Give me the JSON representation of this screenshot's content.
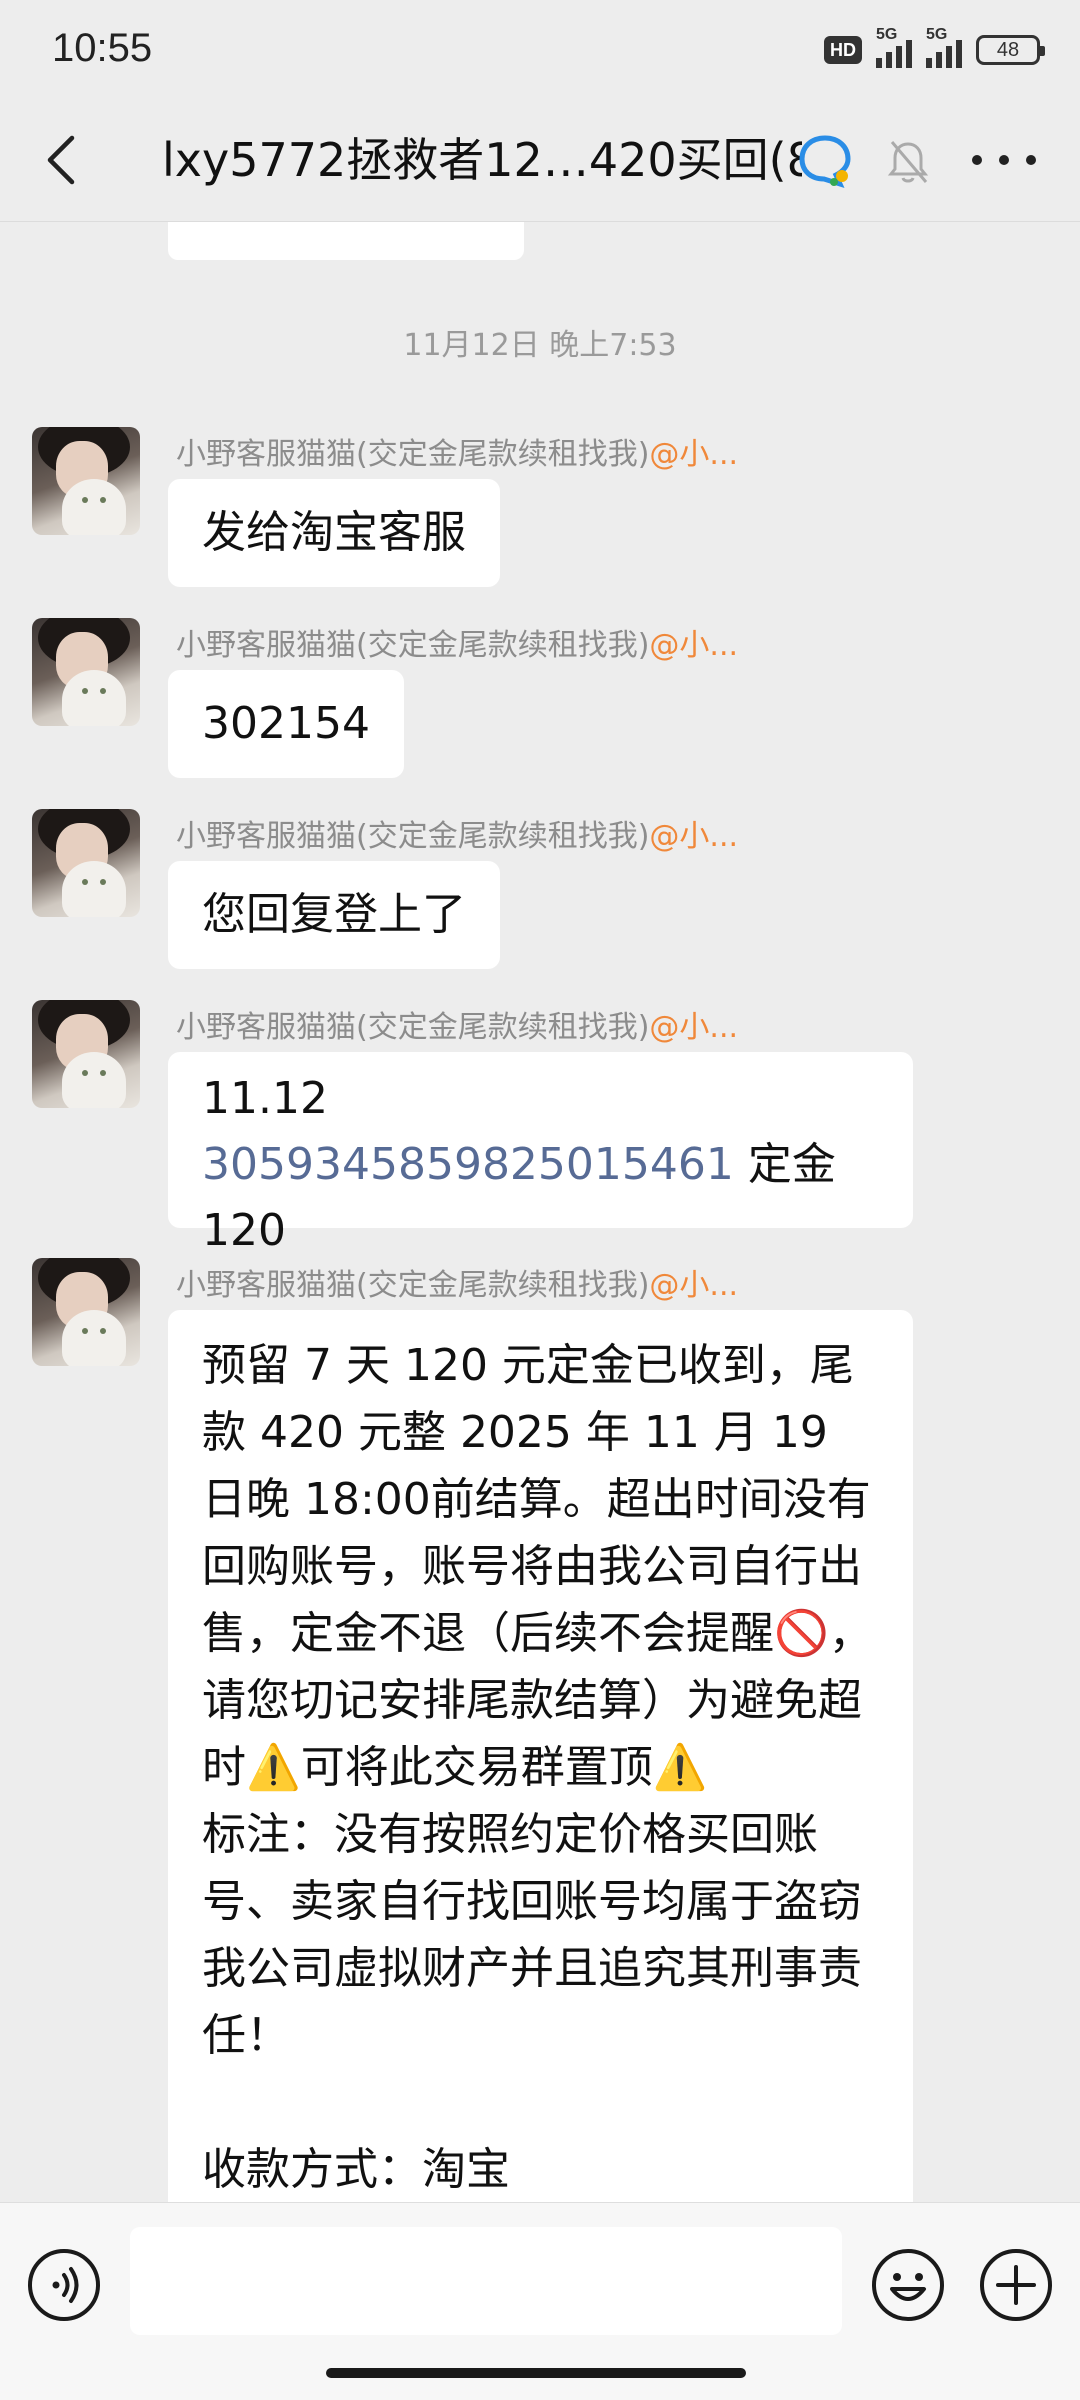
{
  "status_bar": {
    "time": "10:55",
    "hd_label": "HD",
    "network_1": "5G",
    "network_2": "5G",
    "battery": "48"
  },
  "header": {
    "title": "lxy5772拯救者12…420买回(8)",
    "back_icon": "chevron-left-icon",
    "title_icon": "group-chat-icon",
    "mute_icon": "bell-muted-icon",
    "more_icon": "more-dots-icon"
  },
  "chat": {
    "timestamp": "11月12日 晚上7:53",
    "messages": [
      {
        "sender_name": "小野客服猫猫(交定金尾款续租找我)",
        "sender_mention": "@小...",
        "text": "发给淘宝客服"
      },
      {
        "sender_name": "小野客服猫猫(交定金尾款续租找我)",
        "sender_mention": "@小...",
        "text": "302154"
      },
      {
        "sender_name": "小野客服猫猫(交定金尾款续租找我)",
        "sender_mention": "@小...",
        "text": "您回复登上了"
      },
      {
        "sender_name": "小野客服猫猫(交定金尾款续租找我)",
        "sender_mention": "@小...",
        "line1": "11.12",
        "link": "3059345859825015461",
        "suffix": " 定金 120"
      },
      {
        "sender_name": "小野客服猫猫(交定金尾款续租找我)",
        "sender_mention": "@小...",
        "text": "预留 7 天 120 元定金已收到，尾款 420 元整 2025 年 11 月 19 日晚 18:00前结算。超出时间没有回购账号，账号将由我公司自行出售，定金不退（后续不会提醒🚫，请您切记安排尾款结算）为避免超时⚠️可将此交易群置顶⚠️\n标注：没有按照约定价格买回账号、卖家自行找回账号均属于盗窃我公司虚拟财产并且追究其刑事责任！\n\n收款方式：淘宝"
      }
    ]
  },
  "input_bar": {
    "voice_icon": "voice-icon",
    "emoji_icon": "emoji-icon",
    "plus_icon": "plus-icon",
    "placeholder": ""
  },
  "colors": {
    "background": "#ededed",
    "bubble": "#ffffff",
    "link": "#576b95",
    "mention": "#f0883a",
    "meta_text": "#8c8c8c"
  }
}
